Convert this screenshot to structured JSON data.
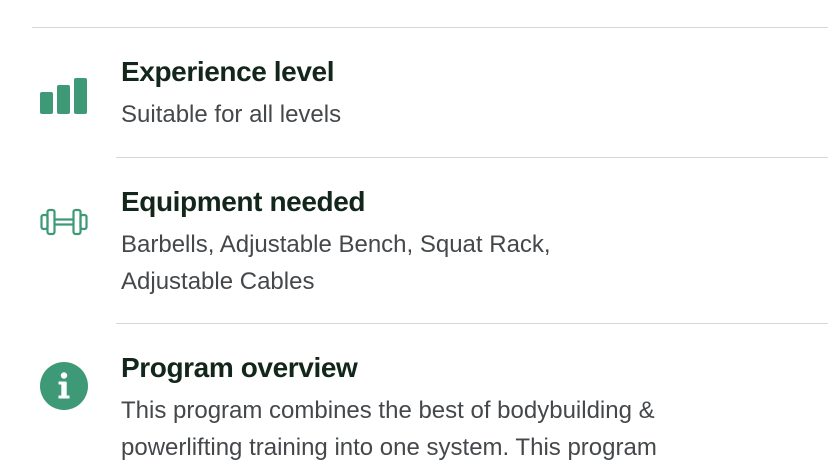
{
  "colors": {
    "accent": "#3e9a76",
    "title": "#13261b",
    "body": "#45484b",
    "divider": "#d6d6d6"
  },
  "details": [
    {
      "icon": "bar-chart-icon",
      "title": "Experience level",
      "text": "Suitable for all levels"
    },
    {
      "icon": "dumbbell-icon",
      "title": "Equipment needed",
      "text": "Barbells, Adjustable Bench, Squat Rack, Adjustable Cables"
    },
    {
      "icon": "info-icon",
      "title": "Program overview",
      "text": "This program combines the best of bodybuilding & powerlifting training into one system. This program"
    }
  ]
}
